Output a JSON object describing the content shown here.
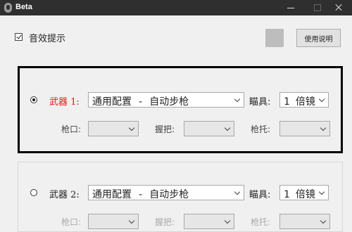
{
  "window": {
    "title": "Beta"
  },
  "settings": {
    "sound_label": "音效提示",
    "help_label": "使用说明"
  },
  "weapons": [
    {
      "label": "武器 1:",
      "preset": "通用配置 - 自动步枪",
      "scope_label": "瞄具:",
      "scope": "1 倍镜",
      "muzzle_label": "枪口:",
      "grip_label": "握把:",
      "stock_label": "枪托:",
      "selected": true
    },
    {
      "label": "武器 2:",
      "preset": "通用配置 - 自动步枪",
      "scope_label": "瞄具:",
      "scope": "1 倍镜",
      "muzzle_label": "枪口:",
      "grip_label": "握把:",
      "stock_label": "枪托:",
      "selected": false
    }
  ],
  "colors": {
    "active_label": "#e01818",
    "titlebar": "#2f2f2f",
    "swatch": "#bdbdbd"
  }
}
